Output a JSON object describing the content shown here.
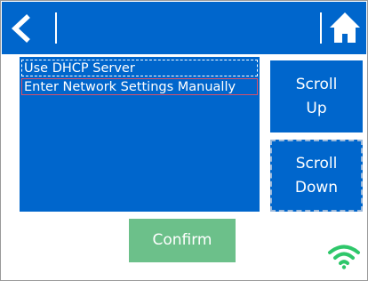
{
  "header": {
    "back_icon": "chevron-left-icon",
    "home_icon": "home-icon"
  },
  "options": [
    {
      "label": "Use DHCP Server",
      "state": "focused"
    },
    {
      "label": "Enter Network Settings Manually",
      "state": "selected"
    }
  ],
  "scroll": {
    "up_line1": "Scroll",
    "up_line2": "Up",
    "down_line1": "Scroll",
    "down_line2": "Down"
  },
  "confirm_label": "Confirm",
  "status": {
    "wifi_icon": "wifi-icon"
  },
  "colors": {
    "primary": "#0066cc",
    "confirm_disabled": "#6cc08a",
    "wifi": "#2ec76a",
    "selected_outline": "#d7506a"
  }
}
